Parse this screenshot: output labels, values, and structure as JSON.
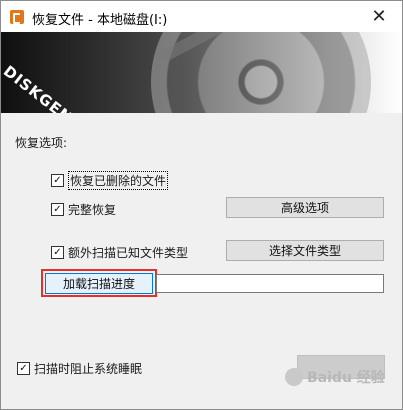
{
  "window": {
    "title": "恢复文件 - 本地磁盘(I:)",
    "close_label": "✕"
  },
  "banner": {
    "brand_text": "DISKGENIUS"
  },
  "options": {
    "section_label": "恢复选项:",
    "recover_deleted": {
      "label": "恢复已删除的文件",
      "checked": true
    },
    "full_recovery": {
      "label": "完整恢复",
      "checked": true
    },
    "extra_scan": {
      "label": "额外扫描已知文件类型",
      "checked": true
    }
  },
  "buttons": {
    "advanced": "高级选项",
    "select_file_types": "选择文件类型",
    "load_progress": "加载扫描进度"
  },
  "load_progress_path": {
    "value": ""
  },
  "footer": {
    "prevent_sleep": {
      "label": "扫描时阻止系统睡眠",
      "checked": true
    },
    "action_button_label": ""
  },
  "watermark": {
    "text": "Baidu 经验"
  },
  "colors": {
    "highlight": "#e3302c",
    "app_icon": "#e2761c",
    "button_hot_border": "#0078d7"
  }
}
